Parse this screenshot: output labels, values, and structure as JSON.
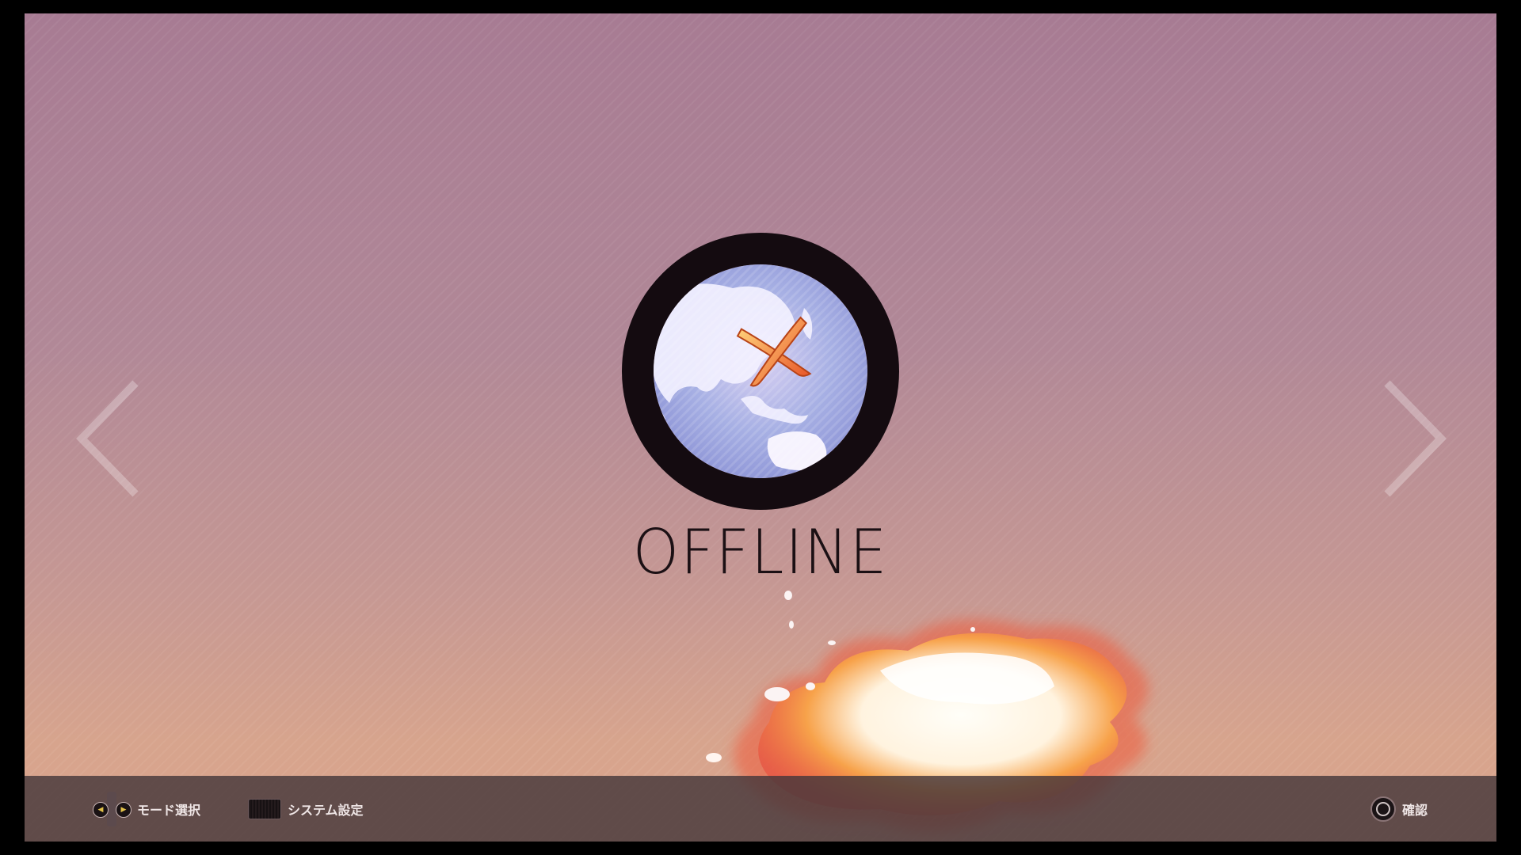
{
  "screen": {
    "mode_title": "OFFLINE",
    "mode_icon": "globe-with-x-icon",
    "accent_color": "#f08a2a"
  },
  "navigation": {
    "prev_icon": "chevron-left-icon",
    "next_icon": "chevron-right-icon"
  },
  "bottom_bar": {
    "mode_select": {
      "icon": "dpad-left-right-icon",
      "label": "モード選択"
    },
    "system_settings": {
      "icon": "touchpad-button-icon",
      "label": "システム設定"
    },
    "confirm": {
      "icon": "circle-button-icon",
      "label": "確認"
    }
  }
}
